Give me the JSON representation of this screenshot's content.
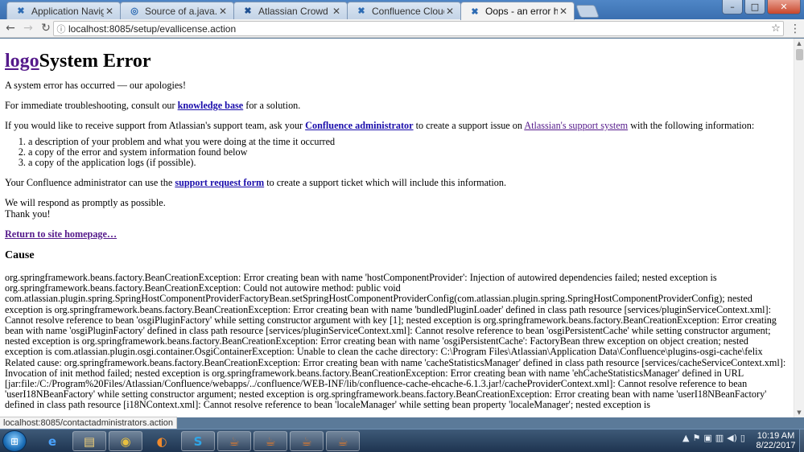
{
  "tabs": [
    {
      "title": "Application Navigator - ¦",
      "icon": "atlassian-icon",
      "glyph": "✖",
      "color": "#2d6bb3"
    },
    {
      "title": "Source of a.java.txt - Sou",
      "icon": "sourcetree-icon",
      "glyph": "◎",
      "color": "#2d6bb3"
    },
    {
      "title": "Atlassian Crowd - View a",
      "icon": "crowd-icon",
      "glyph": "✖",
      "color": "#1d4f91"
    },
    {
      "title": "Confluence Cloud suppo",
      "icon": "confluence-icon",
      "glyph": "✖",
      "color": "#2d6bb3"
    },
    {
      "title": "Oops - an error has occu",
      "icon": "confluence-icon",
      "glyph": "✖",
      "color": "#2d6bb3"
    }
  ],
  "address": {
    "url": "localhost:8085/setup/evallicense.action"
  },
  "page": {
    "logo": "logo",
    "title": "System Error",
    "intro": "A system error has occurred — our apologies!",
    "troubleshoot_pre": "For immediate troubleshooting, consult our ",
    "kb_link": "knowledge base",
    "troubleshoot_post": " for a solution.",
    "support_pre": "If you would like to receive support from Atlassian's support team, ask your ",
    "admin_link": "Confluence administrator",
    "support_mid": " to create a support issue on ",
    "support_system_link": "Atlassian's support system",
    "support_post": " with the following information:",
    "list": [
      "a description of your problem and what you were doing at the time it occurred",
      "a copy of the error and system information found below",
      "a copy of the application logs (if possible)."
    ],
    "form_pre": "Your Confluence administrator can use the ",
    "form_link": "support request form",
    "form_post": " to create a support ticket which will include this information.",
    "respond": "We will respond as promptly as possible.",
    "thanks": "Thank you!",
    "return_link": "Return to site homepage…",
    "cause_heading": "Cause",
    "cause_text": "org.springframework.beans.factory.BeanCreationException: Error creating bean with name 'hostComponentProvider': Injection of autowired dependencies failed; nested exception is org.springframework.beans.factory.BeanCreationException: Could not autowire method: public void com.atlassian.plugin.spring.SpringHostComponentProviderFactoryBean.setSpringHostComponentProviderConfig(com.atlassian.plugin.spring.SpringHostComponentProviderConfig); nested exception is org.springframework.beans.factory.BeanCreationException: Error creating bean with name 'bundledPluginLoader' defined in class path resource [services/pluginServiceContext.xml]: Cannot resolve reference to bean 'osgiPluginFactory' while setting constructor argument with key [1]; nested exception is org.springframework.beans.factory.BeanCreationException: Error creating bean with name 'osgiPluginFactory' defined in class path resource [services/pluginServiceContext.xml]: Cannot resolve reference to bean 'osgiPersistentCache' while setting constructor argument; nested exception is org.springframework.beans.factory.BeanCreationException: Error creating bean with name 'osgiPersistentCache': FactoryBean threw exception on object creation; nested exception is com.atlassian.plugin.osgi.container.OsgiContainerException: Unable to clean the cache directory: C:\\Program Files\\Atlassian\\Application Data\\Confluence\\plugins-osgi-cache\\felix Related cause: org.springframework.beans.factory.BeanCreationException: Error creating bean with name 'cacheStatisticsManager' defined in class path resource [services/cacheServiceContext.xml]: Invocation of init method failed; nested exception is org.springframework.beans.factory.BeanCreationException: Error creating bean with name 'ehCacheStatisticsManager' defined in URL [jar:file:/C:/Program%20Files/Atlassian/Confluence/webapps/../confluence/WEB-INF/lib/confluence-cache-ehcache-6.1.3.jar!/cacheProviderContext.xml]: Cannot resolve reference to bean 'userI18NBeanFactory' while setting constructor argument; nested exception is org.springframework.beans.factory.BeanCreationException: Error creating bean with name 'userI18NBeanFactory' defined in class path resource [i18NContext.xml]: Cannot resolve reference to bean 'localeManager' while setting bean property 'localeManager'; nested exception is"
  },
  "status_url": "localhost:8085/contactadministrators.action",
  "taskbar": {
    "time": "10:19 AM",
    "date": "8/22/2017"
  },
  "colors": {
    "link": "#1a0dab",
    "visited": "#551a8b"
  }
}
